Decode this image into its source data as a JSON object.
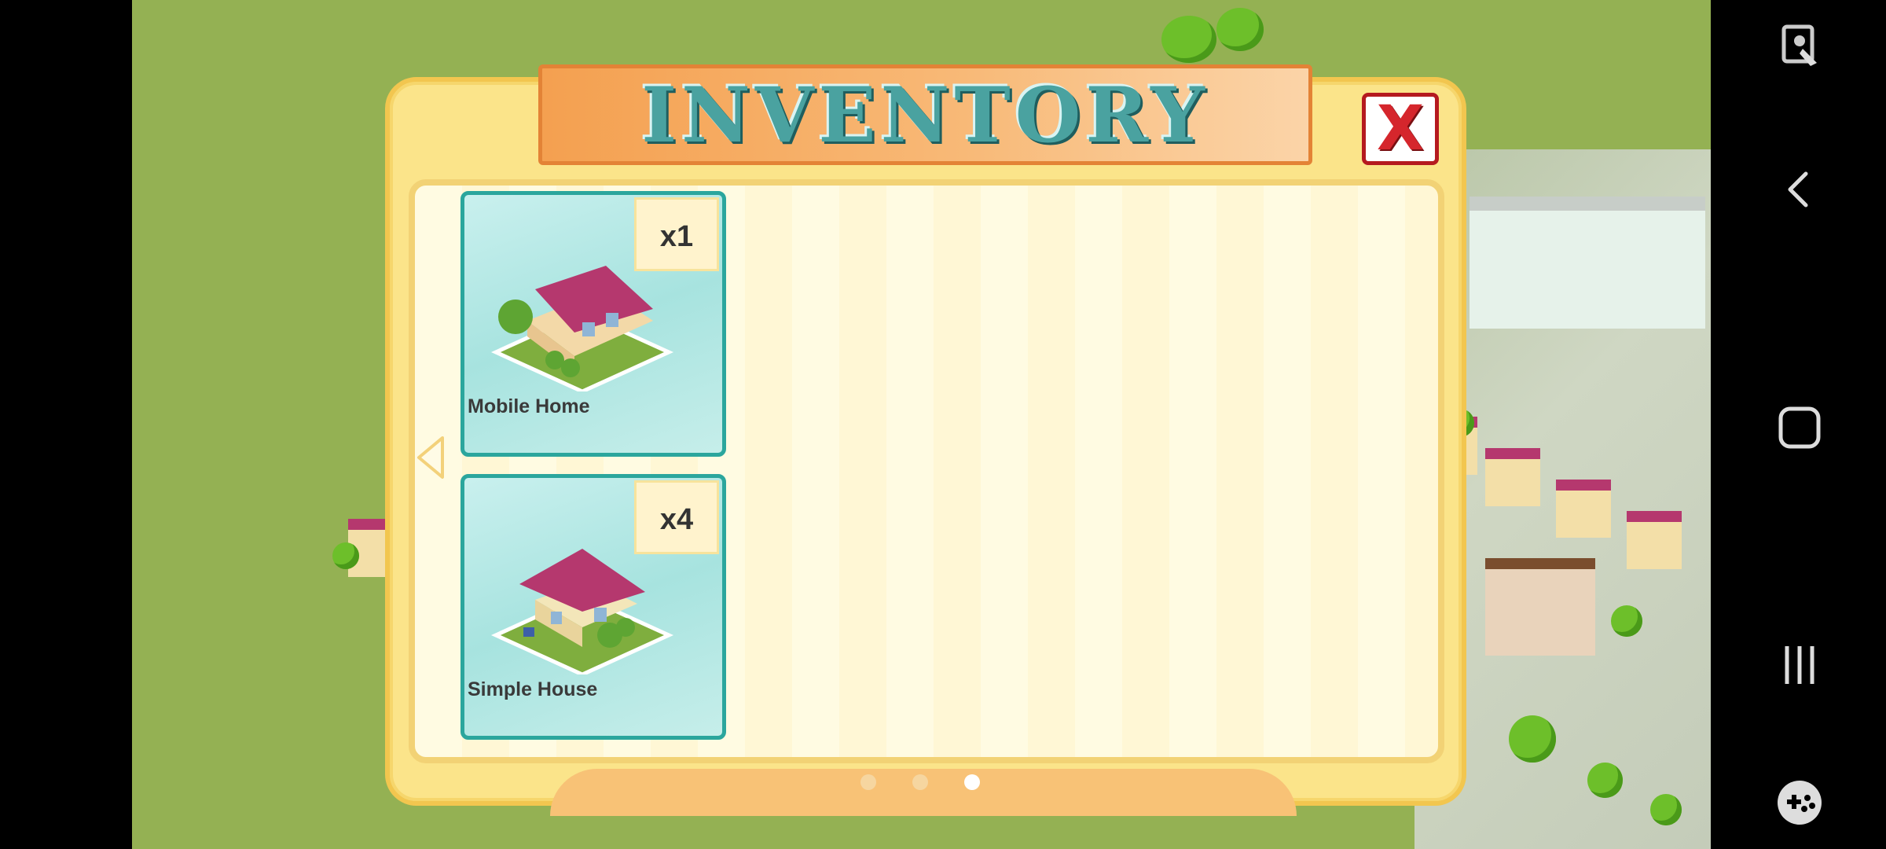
{
  "window": {
    "title": "INVENTORY",
    "close_label": "X"
  },
  "inventory": {
    "items": [
      {
        "name": "Mobile Home",
        "count": "x1"
      },
      {
        "name": "Simple House",
        "count": "x4"
      }
    ]
  },
  "pagination": {
    "pages": 3,
    "current": 3
  },
  "system_nav": {
    "icons": [
      "screen-capture-icon",
      "back-icon",
      "home-icon",
      "recent-apps-icon",
      "game-booster-icon"
    ]
  },
  "colors": {
    "title_text": "#4aa2a0",
    "close_red": "#d5262c",
    "card_border": "#2ba69d",
    "panel_bg": "#fbe48a"
  }
}
